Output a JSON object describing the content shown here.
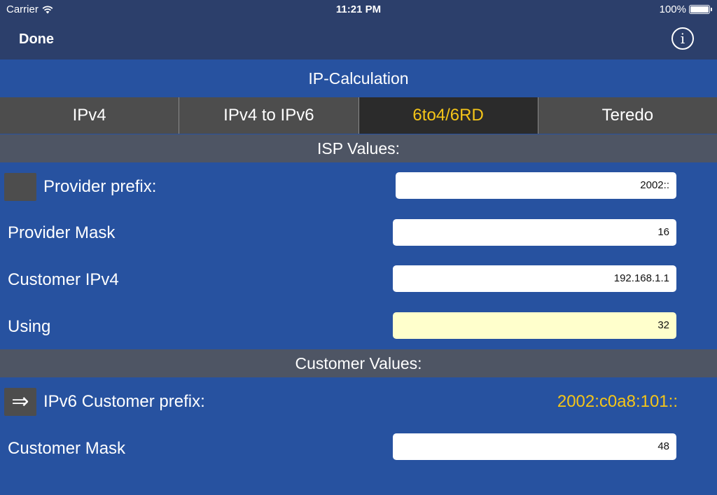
{
  "status": {
    "carrier": "Carrier",
    "time": "11:21 PM",
    "battery": "100%"
  },
  "nav": {
    "done": "Done",
    "info": "i"
  },
  "title": "IP-Calculation",
  "tabs": [
    {
      "label": "IPv4"
    },
    {
      "label": "IPv4 to IPv6"
    },
    {
      "label": "6to4/6RD",
      "active": true
    },
    {
      "label": "Teredo"
    }
  ],
  "isp": {
    "header": "ISP Values:",
    "provider_prefix": {
      "label": "Provider prefix:",
      "value": "2002::"
    },
    "provider_mask": {
      "label": "Provider Mask",
      "value": "16"
    },
    "customer_ipv4": {
      "label": "Customer IPv4",
      "value": "192.168.1.1"
    },
    "using": {
      "label": "Using",
      "value": "32"
    }
  },
  "customer": {
    "header": "Customer Values:",
    "ipv6_prefix": {
      "label": "IPv6 Customer prefix:",
      "button_icon": "⇒",
      "value": "2002:c0a8:101::"
    },
    "mask": {
      "label": "Customer Mask",
      "value": "48"
    }
  },
  "colors": {
    "background": "#2752a0",
    "navbar": "#2c3f6b",
    "accent": "#f5c518",
    "section_header": "#4e5564",
    "segment": "#4d4d4d",
    "segment_active": "#2b2b2b",
    "highlight_field": "#ffffcc"
  },
  "icons": {
    "wifi": "wifi-icon",
    "battery": "battery-icon",
    "info": "info-icon",
    "arrow": "double-arrow-right-icon"
  }
}
